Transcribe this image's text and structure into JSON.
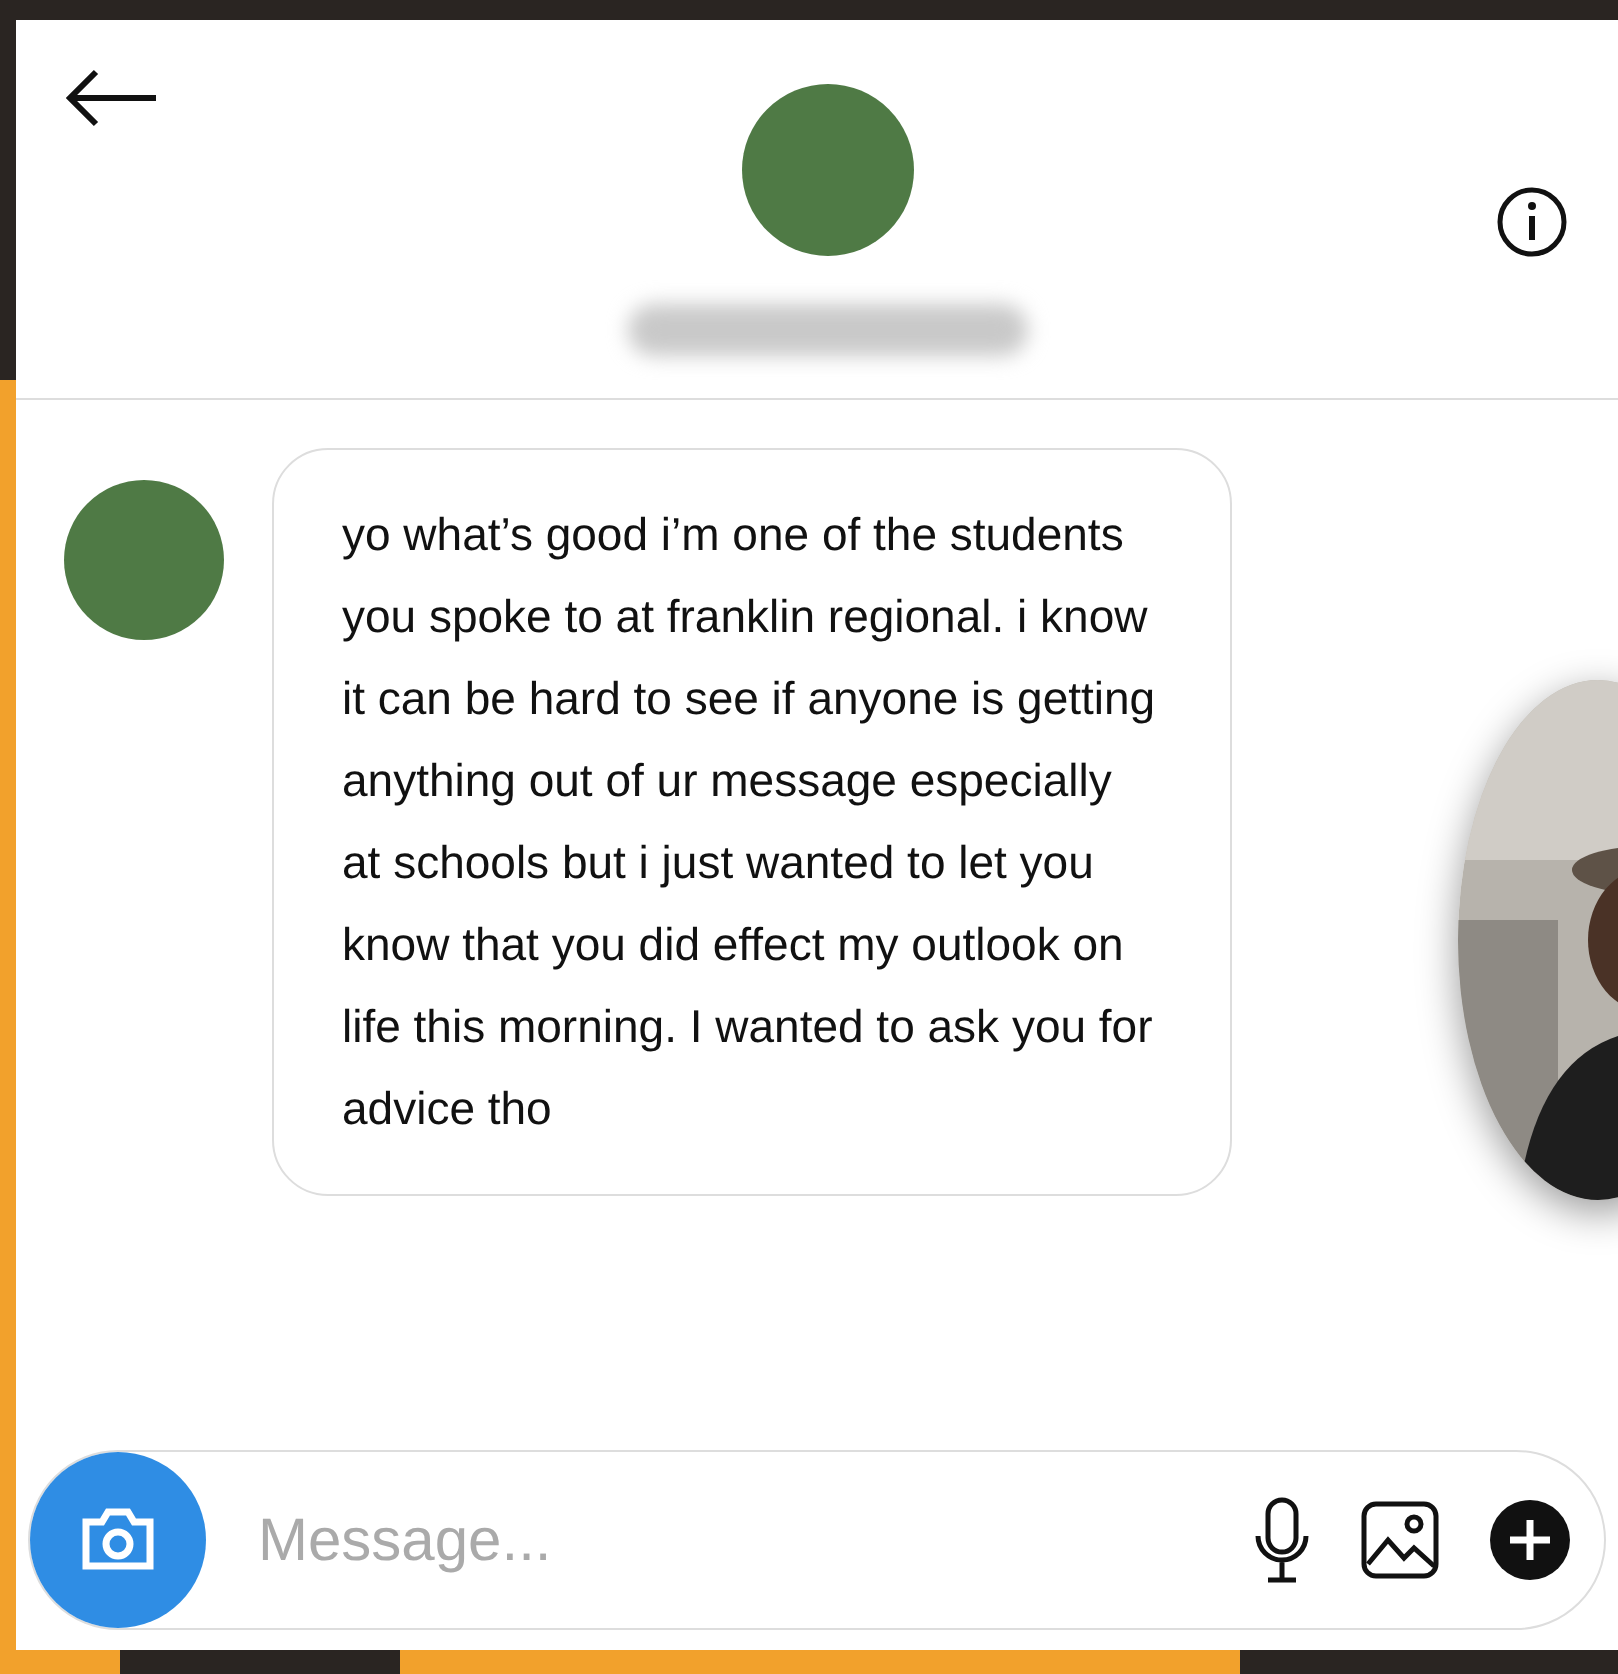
{
  "messages": [
    {
      "text": "yo what’s good i’m one of the students you spoke to at franklin regional. i know it can be hard to see if anyone is getting anything out of ur message especially at schools but i just wanted to let you know that you did effect my outlook on life this morning. I wanted to ask you for advice tho"
    }
  ],
  "composer": {
    "placeholder": "Message..."
  }
}
